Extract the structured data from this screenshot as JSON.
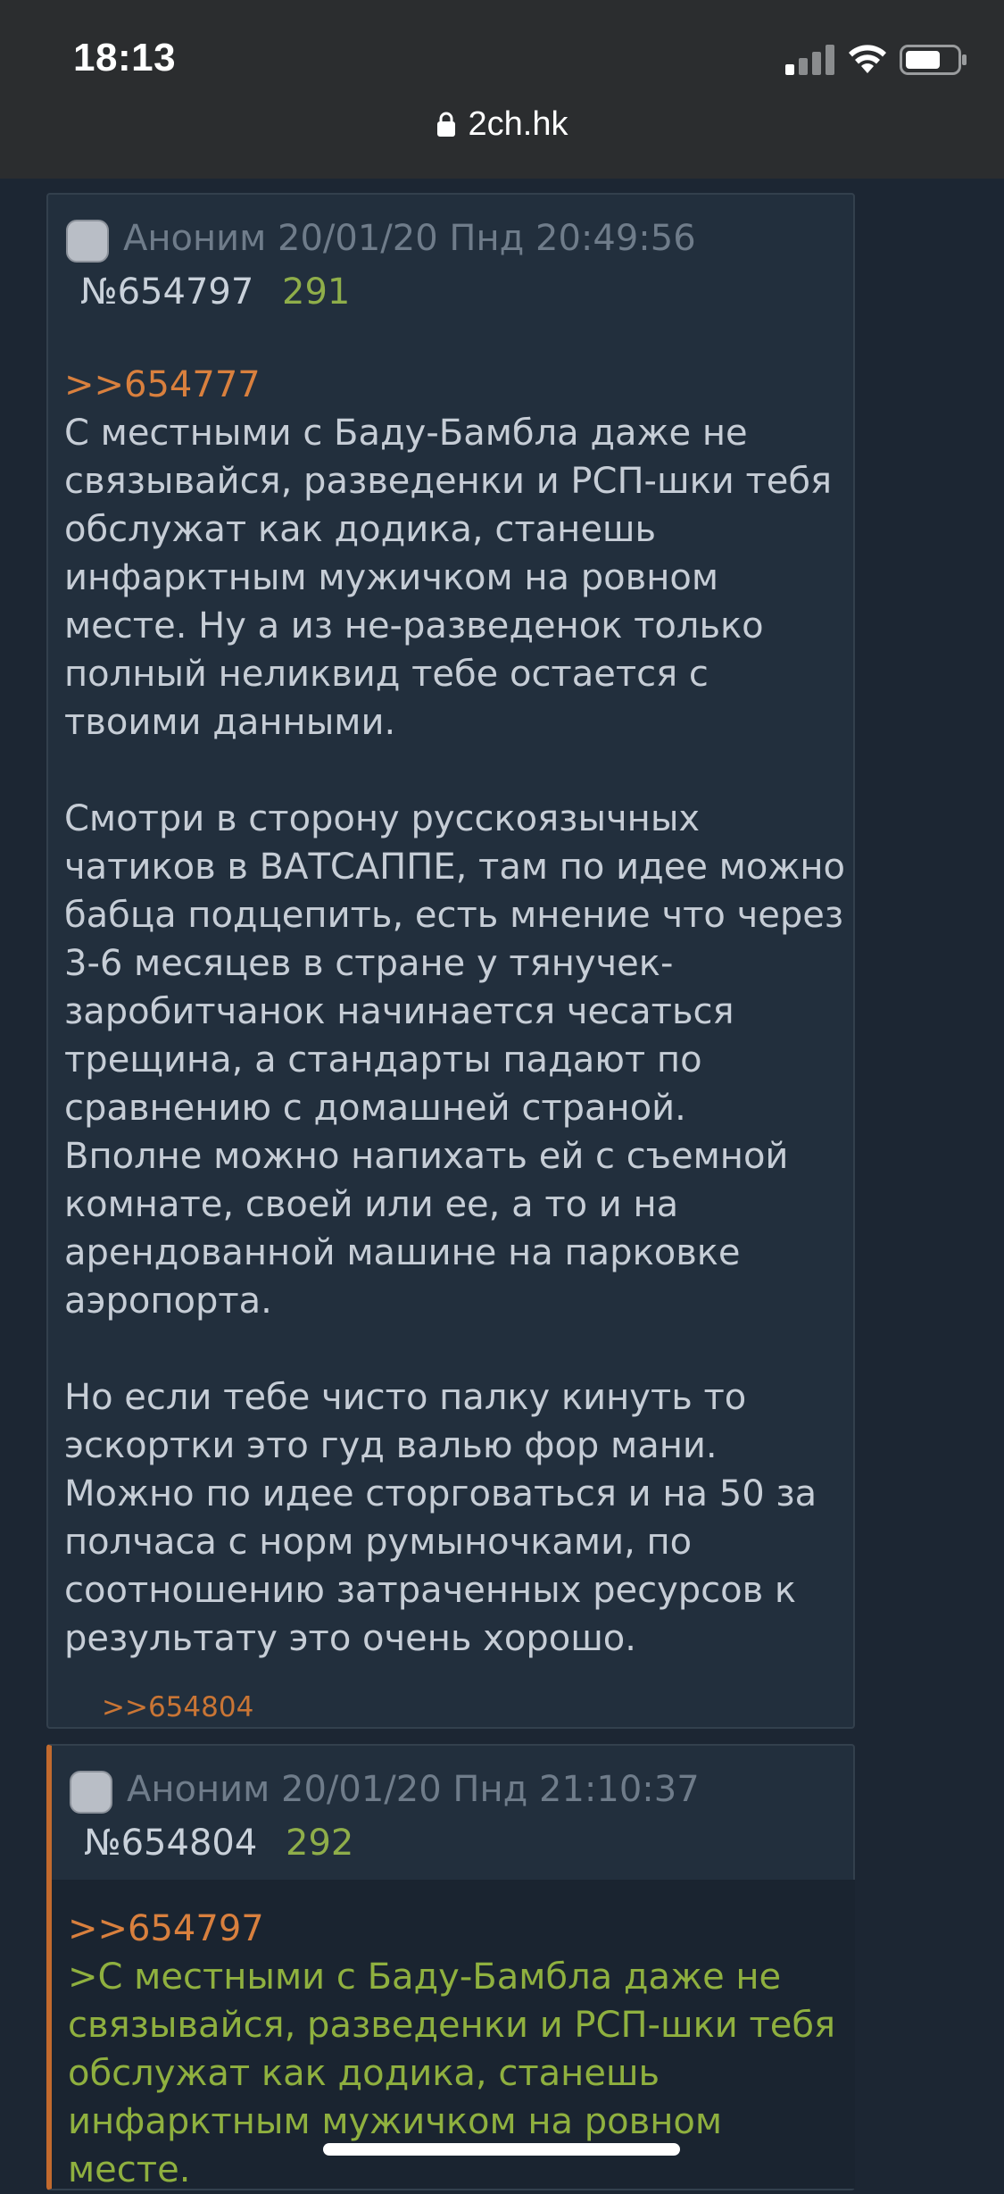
{
  "status_bar": {
    "time": "18:13",
    "url": "2ch.hk"
  },
  "posts": [
    {
      "author": "Аноним",
      "datetime": "20/01/20 Пнд 20:49:56",
      "number": "№654797",
      "count": "291",
      "reply_to": ">>654777",
      "paragraphs": [
        "С местными с Баду-Бамбла даже не связывайся, разведенки и РСП-шки тебя обслужат как додика, станешь инфарктным мужичком на ровном месте. Ну а из не-разведенок только полный неликвид тебе остается с твоими данными.",
        "Смотри в сторону русскоязычных чатиков в ВАТСАППЕ, там по идее можно бабца подцепить, есть мнение что через 3-6 месяцев в стране у тянучек-заробитчанок начинается чесаться трещина, а стандарты падают по сравнению с домашней страной.",
        "Вполне можно напихать ей с съемной комнате, своей или ее, а то и на арендованной машине на парковке аэропорта.",
        "Но если тебе чисто палку кинуть то эскортки это гуд валью фор мани. Можно по идее сторговаться и на 50 за полчаса с норм румыночками, по соотношению затраченных ресурсов к результату это очень хорошо."
      ],
      "backlink": ">>654804"
    },
    {
      "author": "Аноним",
      "datetime": "20/01/20 Пнд 21:10:37",
      "number": "№654804",
      "count": "292",
      "reply_to": ">>654797",
      "quote": ">С местными с Баду-Бамбла даже не связывайся, разведенки и РСП-шки тебя обслужат как додика, станешь инфарктным мужичком на ровном месте."
    }
  ]
}
